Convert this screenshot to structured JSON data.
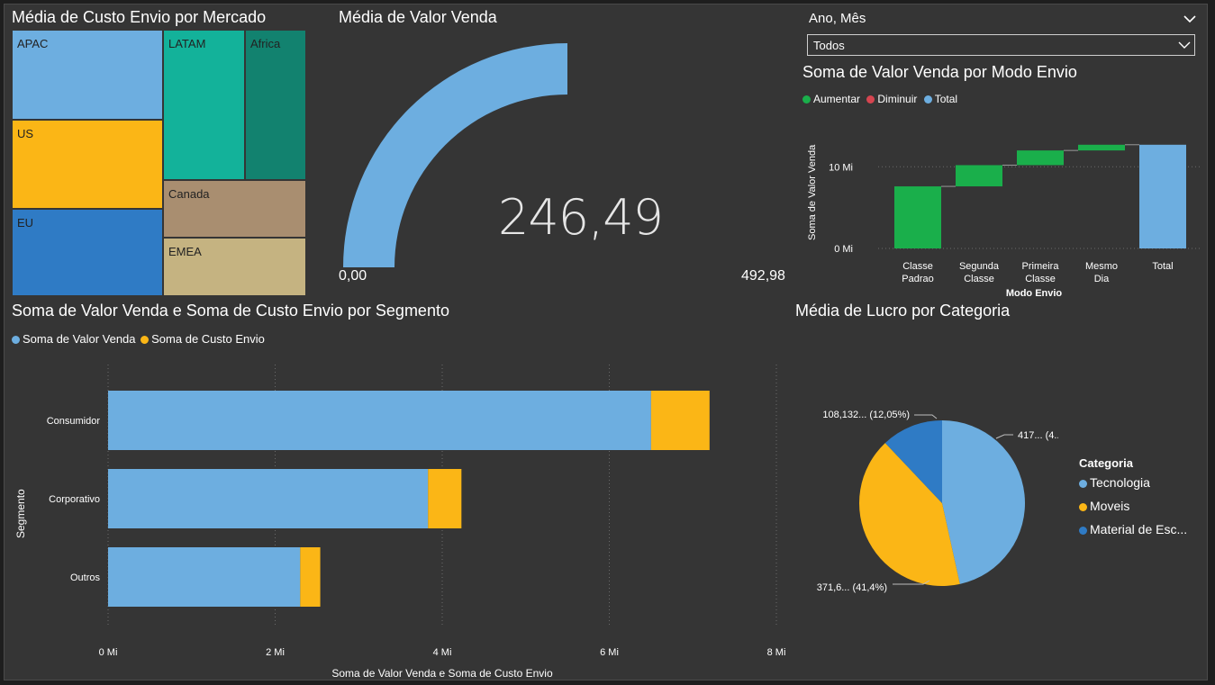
{
  "treemap": {
    "title": "Média de Custo Envio por Mercado",
    "tiles": [
      {
        "label": "APAC",
        "color": "#6daee0"
      },
      {
        "label": "US",
        "color": "#fbb616"
      },
      {
        "label": "EU",
        "color": "#2f7bc5"
      },
      {
        "label": "LATAM",
        "color": "#13b29a"
      },
      {
        "label": "Africa",
        "color": "#12826f"
      },
      {
        "label": "Canada",
        "color": "#a98e70"
      },
      {
        "label": "EMEA",
        "color": "#c5b381"
      }
    ]
  },
  "gauge": {
    "title": "Média de Valor Venda",
    "value_label": "246,49",
    "min_label": "0,00",
    "max_label": "492,98",
    "value": 246.49,
    "min": 0,
    "max": 492.98,
    "color": "#6daee0"
  },
  "slicer": {
    "label": "Ano, Mês",
    "selected": "Todos"
  },
  "waterfall": {
    "title": "Soma de Valor Venda por Modo Envio",
    "legend": [
      {
        "label": "Aumentar",
        "color": "#1aaf4b"
      },
      {
        "label": "Diminuir",
        "color": "#d64550"
      },
      {
        "label": "Total",
        "color": "#6daee0"
      }
    ],
    "ylabel": "Soma de Valor Venda",
    "xlabel": "Modo Envio",
    "yticks": [
      "0 Mi",
      "10 Mi"
    ],
    "categories": [
      [
        "Classe",
        "Padrao"
      ],
      [
        "Segunda",
        "Classe"
      ],
      [
        "Primeira",
        "Classe"
      ],
      [
        "Mesmo",
        "Dia"
      ],
      [
        "Total"
      ]
    ]
  },
  "barchart": {
    "title": "Soma de Valor Venda e Soma de Custo Envio por Segmento",
    "legend": [
      {
        "label": "Soma de Valor Venda",
        "color": "#6daee0"
      },
      {
        "label": "Soma de Custo Envio",
        "color": "#fbb616"
      }
    ],
    "ylabel": "Segmento",
    "xlabel": "Soma de Valor Venda e Soma de Custo Envio",
    "xticks": [
      "0 Mi",
      "2 Mi",
      "4 Mi",
      "6 Mi",
      "8 Mi"
    ]
  },
  "pie": {
    "title": "Média de Lucro por Categoria",
    "legend_title": "Categoria",
    "labels": [
      "417... (4...)",
      "371,6... (41,4%)",
      "108,132... (12,05%)"
    ],
    "legend": [
      {
        "label": "Tecnologia",
        "color": "#6daee0"
      },
      {
        "label": "Moveis",
        "color": "#fbb616"
      },
      {
        "label": "Material de Esc...",
        "color": "#2f7bc5"
      }
    ]
  },
  "chart_data": [
    {
      "type": "bar",
      "title": "Soma de Valor Venda por Modo Envio",
      "subtype": "waterfall",
      "categories": [
        "Classe Padrao",
        "Segunda Classe",
        "Primeira Classe",
        "Mesmo Dia",
        "Total"
      ],
      "values": [
        7.6,
        2.6,
        1.8,
        0.7,
        12.7
      ],
      "ylabel": "Soma de Valor Venda",
      "xlabel": "Modo Envio",
      "ylim": [
        0,
        14
      ],
      "yunit": "Mi"
    },
    {
      "type": "bar",
      "title": "Soma de Valor Venda e Soma de Custo Envio por Segmento",
      "orientation": "horizontal",
      "stacked": true,
      "categories": [
        "Consumidor",
        "Corporativo",
        "Outros"
      ],
      "series": [
        {
          "name": "Soma de Valor Venda",
          "values": [
            6.5,
            3.83,
            2.3
          ]
        },
        {
          "name": "Soma de Custo Envio",
          "values": [
            0.7,
            0.4,
            0.24
          ]
        }
      ],
      "xlabel": "Soma de Valor Venda e Soma de Custo Envio",
      "ylabel": "Segmento",
      "xlim": [
        0,
        8
      ],
      "xunit": "Mi"
    },
    {
      "type": "pie",
      "title": "Média de Lucro por Categoria",
      "categories": [
        "Tecnologia",
        "Moveis",
        "Material de Esc..."
      ],
      "values": [
        46.55,
        41.4,
        12.05
      ],
      "unit": "%"
    }
  ]
}
